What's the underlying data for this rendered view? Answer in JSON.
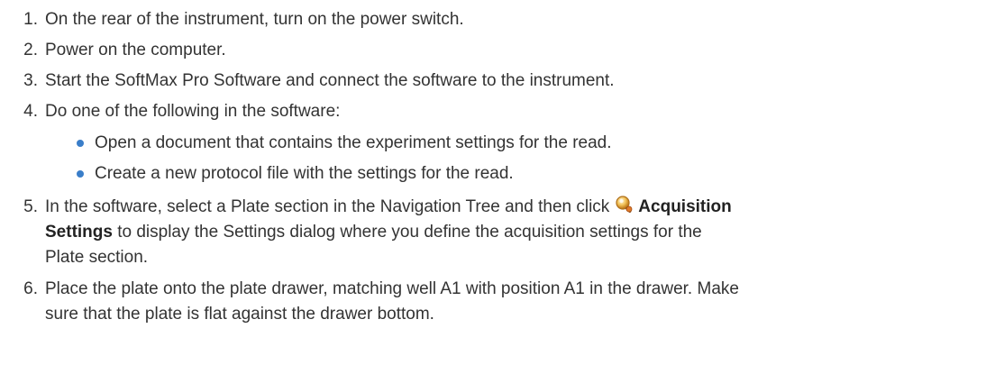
{
  "steps": [
    {
      "num": "1.",
      "text": "On the rear of the instrument, turn on the power switch."
    },
    {
      "num": "2.",
      "text": "Power on the computer."
    },
    {
      "num": "3.",
      "text": "Start the SoftMax Pro Software and connect the software to the instrument."
    },
    {
      "num": "4.",
      "text": "Do one of the following in the software:"
    },
    {
      "num": "5.",
      "text_before": "In the software, select a Plate section in the Navigation Tree and then click",
      "bold_1": "Acquisition",
      "bold_2": "Settings",
      "text_after": "to display the Settings dialog where you define the acquisition settings for the",
      "text_end": "Plate section."
    },
    {
      "num": "6.",
      "line1": "Place the plate onto the plate drawer, matching well A1 with position A1 in the drawer. Make",
      "line2": "sure that the plate is flat against the drawer bottom."
    }
  ],
  "sub_bullets": [
    "Open a document that contains the experiment settings for the read.",
    "Create a new protocol file with the settings for the read."
  ],
  "icons": {
    "acquisition_settings": "acquisition-settings-icon"
  },
  "colors": {
    "text": "#333333",
    "bullet": "#3a7ec9"
  }
}
